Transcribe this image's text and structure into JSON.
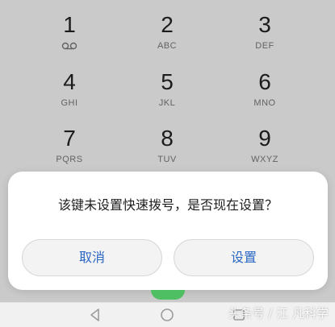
{
  "dialpad": {
    "keys": [
      {
        "digit": "1",
        "letters": ""
      },
      {
        "digit": "2",
        "letters": "ABC"
      },
      {
        "digit": "3",
        "letters": "DEF"
      },
      {
        "digit": "4",
        "letters": "GHI"
      },
      {
        "digit": "5",
        "letters": "JKL"
      },
      {
        "digit": "6",
        "letters": "MNO"
      },
      {
        "digit": "7",
        "letters": "PQRS"
      },
      {
        "digit": "8",
        "letters": "TUV"
      },
      {
        "digit": "9",
        "letters": "WXYZ"
      }
    ]
  },
  "dialog": {
    "message": "该键未设置快速拨号，是否现在设置？",
    "cancel_label": "取消",
    "settings_label": "设置"
  },
  "icons": {
    "voicemail": "voicemail-icon",
    "back": "back-icon",
    "home": "home-icon",
    "recent": "recent-apps-icon"
  },
  "colors": {
    "accent": "#2a66c3",
    "call_button": "#4fbf63"
  },
  "watermark": {
    "text": "头条号 / 江 凡科学"
  }
}
